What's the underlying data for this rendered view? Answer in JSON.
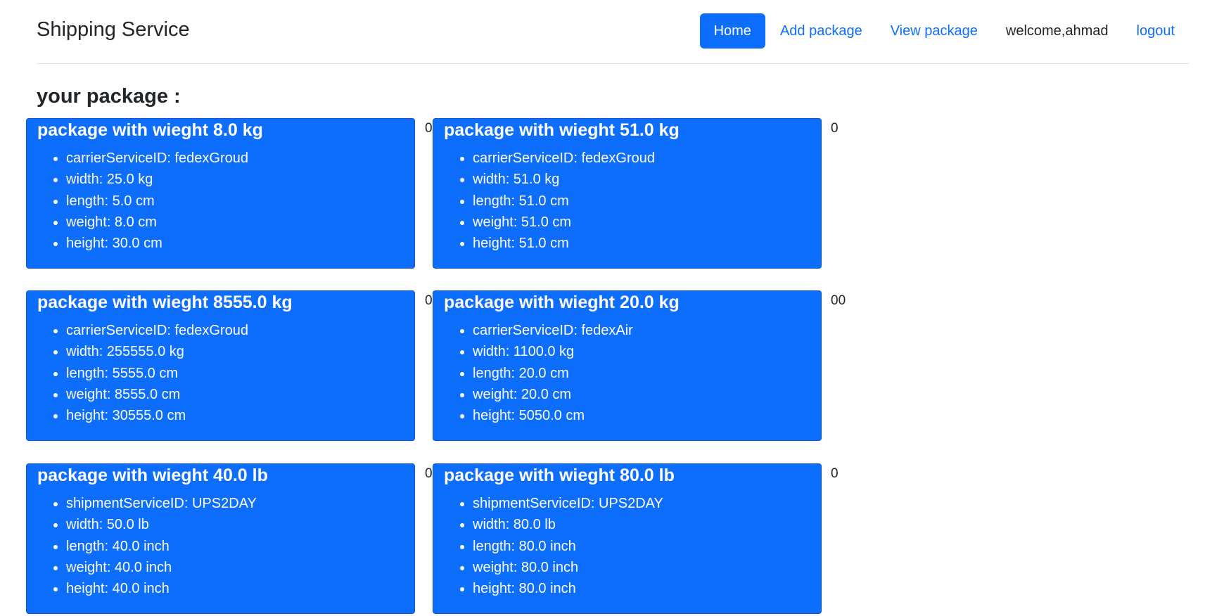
{
  "brand": "Shipping Service",
  "nav": {
    "home": "Home",
    "add_package": "Add package",
    "view_package": "View package",
    "welcome": "welcome,ahmad",
    "logout": "logout"
  },
  "section_title": "your package :",
  "colors": {
    "card_bg": "#0d6efd",
    "link": "#0d6efd"
  },
  "packages": [
    {
      "title": "package with wieght 8.0 kg",
      "count": "0",
      "details": [
        "carrierServiceID: fedexGroud",
        "width: 25.0 kg",
        "length: 5.0 cm",
        "weight: 8.0 cm",
        "height: 30.0 cm"
      ]
    },
    {
      "title": "package with wieght 51.0 kg",
      "count": "0",
      "details": [
        "carrierServiceID: fedexGroud",
        "width: 51.0 kg",
        "length: 51.0 cm",
        "weight: 51.0 cm",
        "height: 51.0 cm"
      ]
    },
    {
      "title": "package with wieght 8555.0 kg",
      "count": "0",
      "details": [
        "carrierServiceID: fedexGroud",
        "width: 255555.0 kg",
        "length: 5555.0 cm",
        "weight: 8555.0 cm",
        "height: 30555.0 cm"
      ]
    },
    {
      "title": "package with wieght 20.0 kg",
      "count": "00",
      "details": [
        "carrierServiceID: fedexAir",
        "width: 1100.0 kg",
        "length: 20.0 cm",
        "weight: 20.0 cm",
        "height: 5050.0 cm"
      ]
    },
    {
      "title": "package with wieght 40.0 lb",
      "count": "0",
      "details": [
        "shipmentServiceID: UPS2DAY",
        "width: 50.0 lb",
        "length: 40.0 inch",
        "weight: 40.0 inch",
        "height: 40.0 inch"
      ]
    },
    {
      "title": "package with wieght 80.0 lb",
      "count": "0",
      "details": [
        "shipmentServiceID: UPS2DAY",
        "width: 80.0 lb",
        "length: 80.0 inch",
        "weight: 80.0 inch",
        "height: 80.0 inch"
      ]
    }
  ]
}
